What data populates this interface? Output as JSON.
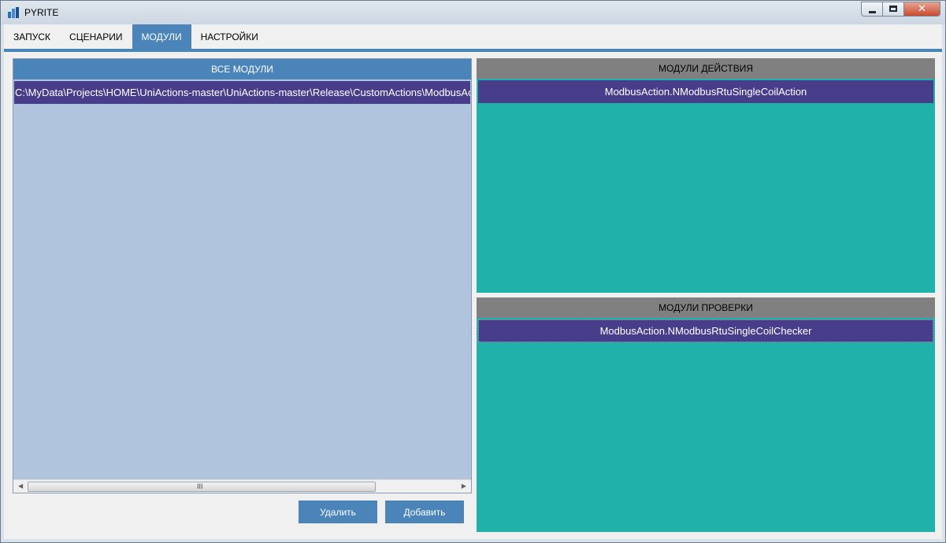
{
  "window": {
    "title": "PYRITE"
  },
  "tabs": [
    {
      "label": "ЗАПУСК"
    },
    {
      "label": "СЦЕНАРИИ"
    },
    {
      "label": "МОДУЛИ"
    },
    {
      "label": "НАСТРОЙКИ"
    }
  ],
  "active_tab": "МОДУЛИ",
  "all_modules": {
    "header": "ВСЕ МОДУЛИ",
    "items": [
      "C:\\MyData\\Projects\\HOME\\UniActions-master\\UniActions-master\\Release\\CustomActions\\ModbusAction.dll"
    ],
    "scroll_grip": "III"
  },
  "buttons": {
    "delete": "Удалить",
    "add": "Добавить"
  },
  "action_modules": {
    "header": "МОДУЛИ ДЕЙСТВИЯ",
    "items": [
      "ModbusAction.NModbusRtuSingleCoilAction"
    ]
  },
  "check_modules": {
    "header": "МОДУЛИ ПРОВЕРКИ",
    "items": [
      "ModbusAction.NModbusRtuSingleCoilChecker"
    ]
  },
  "colors": {
    "accent": "#4a84b8",
    "list_bg": "#b0c4de",
    "selected_item": "#483d8b",
    "module_panel_bg": "#20b2aa",
    "module_header_bg": "#808080"
  }
}
